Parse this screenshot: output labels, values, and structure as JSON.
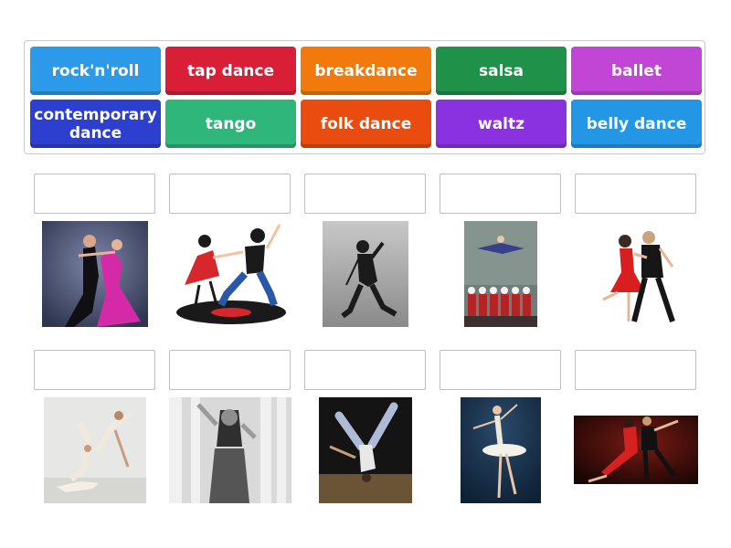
{
  "tiles": [
    {
      "label": "rock'n'roll",
      "color": "#2b9ae8"
    },
    {
      "label": "tap dance",
      "color": "#d81f37"
    },
    {
      "label": "breakdance",
      "color": "#f2790c"
    },
    {
      "label": "salsa",
      "color": "#1f9148"
    },
    {
      "label": "ballet",
      "color": "#c246d6"
    },
    {
      "label": "contemporary dance",
      "color": "#2d3fcf"
    },
    {
      "label": "tango",
      "color": "#2fb67a"
    },
    {
      "label": "folk dance",
      "color": "#ea4b0e"
    },
    {
      "label": "waltz",
      "color": "#8a31e0"
    },
    {
      "label": "belly dance",
      "color": "#2396e6"
    }
  ]
}
